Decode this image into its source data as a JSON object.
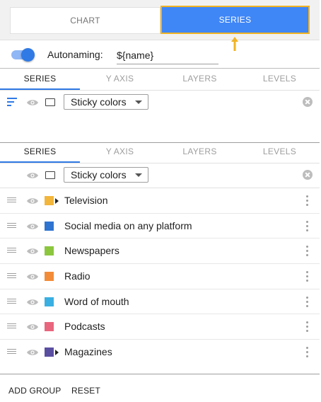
{
  "top_tabs": {
    "chart": "CHART",
    "series": "SERIES"
  },
  "autonaming": {
    "label": "Autonaming:",
    "value": "${name}",
    "enabled": true
  },
  "subtabs": [
    "SERIES",
    "Y AXIS",
    "LAYERS",
    "LEVELS"
  ],
  "color_mode": "Sticky colors",
  "series": [
    {
      "name": "Television",
      "color": "#f2b63c",
      "expandable": true
    },
    {
      "name": "Social media on any platform",
      "color": "#2f74d0",
      "expandable": false
    },
    {
      "name": "Newspapers",
      "color": "#8cc63f",
      "expandable": false
    },
    {
      "name": "Radio",
      "color": "#f28c38",
      "expandable": false
    },
    {
      "name": "Word of mouth",
      "color": "#3ab0e2",
      "expandable": false
    },
    {
      "name": "Podcasts",
      "color": "#e8667e",
      "expandable": false
    },
    {
      "name": "Magazines",
      "color": "#5a4ea1",
      "expandable": true
    }
  ],
  "footer": {
    "add_group": "ADD GROUP",
    "reset": "RESET"
  },
  "colors": {
    "accent": "#2f7ae5",
    "highlight": "#f0b323",
    "tab_active": "#3f86f7"
  }
}
